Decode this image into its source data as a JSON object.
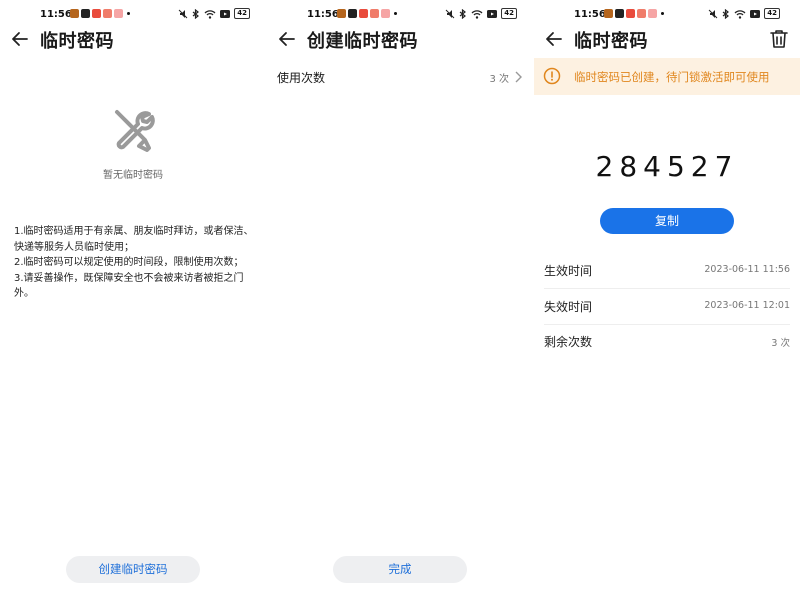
{
  "status_bar": {
    "time": "11:56",
    "battery": "42"
  },
  "screen1": {
    "title": "临时密码",
    "empty_text": "暂无临时密码",
    "description": "1.临时密码适用于有亲属、朋友临时拜访，或者保洁、快递等服务人员临时使用；\n2.临时密码可以规定使用的时间段，限制使用次数；\n3.请妥善操作，既保障安全也不会被来访者被拒之门外。",
    "create_button": "创建临时密码",
    "icons": {
      "back": "back-arrow-icon",
      "empty": "tools-icon"
    }
  },
  "screen2": {
    "title": "创建临时密码",
    "usage_label": "使用次数",
    "usage_value": "3 次",
    "done_button": "完成"
  },
  "screen3": {
    "title": "临时密码",
    "banner_text": "临时密码已创建，待门锁激活即可使用",
    "code": "284527",
    "copy_button": "复制",
    "rows": [
      {
        "label": "生效时间",
        "value": "2023-06-11 11:56"
      },
      {
        "label": "失效时间",
        "value": "2023-06-11 12:01"
      },
      {
        "label": "剩余次数",
        "value": "3 次"
      }
    ]
  },
  "colors": {
    "accent": "#1a73e8",
    "warning": "#e0861d",
    "banner_bg": "#fdf1e1"
  }
}
